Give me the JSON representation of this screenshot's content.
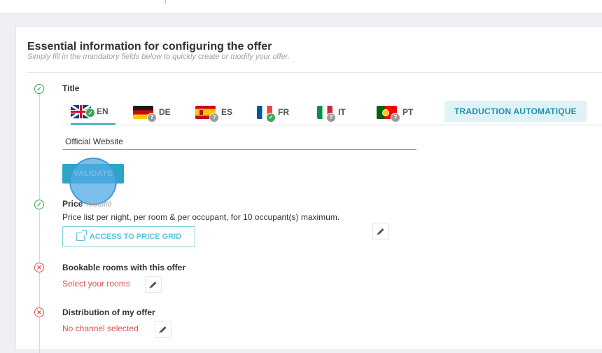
{
  "card": {
    "title": "Essential information for configuring the offer",
    "subtitle": "Simply fill in the mandatory fields below to quickly create or modify your offer."
  },
  "steps": {
    "title": {
      "label": "Title",
      "status": "complete",
      "languages": [
        {
          "code": "EN",
          "flag": "uk-flag-icon",
          "status": "translated",
          "active": true
        },
        {
          "code": "DE",
          "flag": "germany-flag-icon",
          "status": "unknown",
          "active": false
        },
        {
          "code": "ES",
          "flag": "spain-flag-icon",
          "status": "unknown",
          "active": false
        },
        {
          "code": "FR",
          "flag": "france-flag-icon",
          "status": "translated",
          "active": false
        },
        {
          "code": "IT",
          "flag": "italy-flag-icon",
          "status": "unknown",
          "active": false
        },
        {
          "code": "PT",
          "flag": "portugal-flag-icon",
          "status": "unknown",
          "active": false
        }
      ],
      "auto_translate_label": "TRADUCTION AUTOMATIQUE",
      "input_value": "Official Website",
      "validate_label": "VALIDATE"
    },
    "price": {
      "label": "Price",
      "modified_label": "Modifié",
      "status": "complete",
      "description": "Price list per night, per room & per occupant, for 10 occupant(s) maximum.",
      "grid_button_label": "ACCESS TO PRICE GRID"
    },
    "rooms": {
      "label": "Bookable rooms with this offer",
      "status": "error",
      "link": "Select your rooms"
    },
    "distribution": {
      "label": "Distribution of my offer",
      "status": "error",
      "link": "No channel selected"
    }
  },
  "colors": {
    "accent": "#2aa7c4",
    "success": "#3aa757",
    "error": "#d9534f"
  }
}
